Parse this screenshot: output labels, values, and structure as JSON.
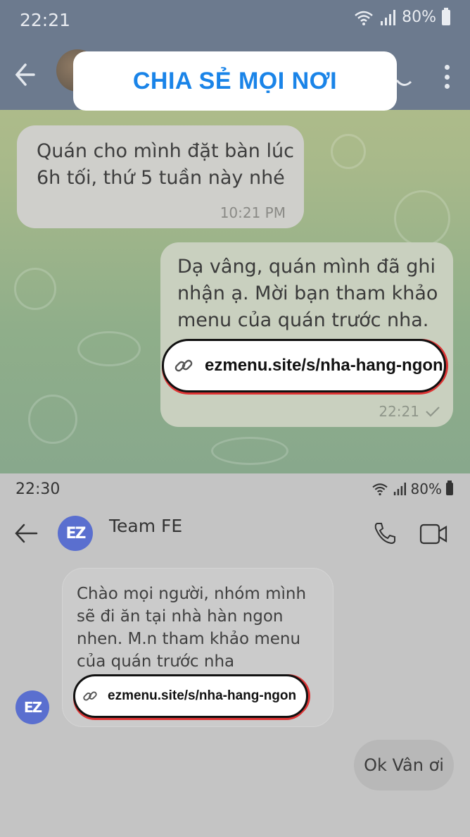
{
  "top_screen": {
    "status_bar": {
      "time": "22:21",
      "battery": "80%"
    },
    "banner": {
      "text": "CHIA SẺ MỌI NƠI"
    },
    "incoming_message": {
      "text": "Quán cho mình đặt bàn lúc 6h tối, thứ 5 tuần này nhé",
      "time": "10:21 PM"
    },
    "outgoing_message": {
      "text": "Dạ vâng, quán mình đã ghi nhận ạ. Mời bạn tham khảo menu của quán trước nha.",
      "link": "ezmenu.site/s/nha-hang-ngon",
      "time": "22:21"
    }
  },
  "bottom_screen": {
    "status_bar": {
      "time": "22:30",
      "battery": "80%"
    },
    "header": {
      "title": "Team FE",
      "avatar_text": "EZ"
    },
    "group_message": {
      "text": "Chào mọi người, nhóm mình sẽ đi ăn tại nhà hàn ngon nhen. M.n tham khảo menu của quán trước nha",
      "link": "ezmenu.site/s/nha-hang-ngon",
      "sender_avatar_text": "EZ"
    },
    "reply_message": {
      "text": "Ok Vân ơi"
    }
  },
  "colors": {
    "banner_text": "#1a84e8",
    "top_header": "#6c7a8e",
    "ez_avatar": "#5a6fcf",
    "link_border_accent": "#dd3333"
  }
}
